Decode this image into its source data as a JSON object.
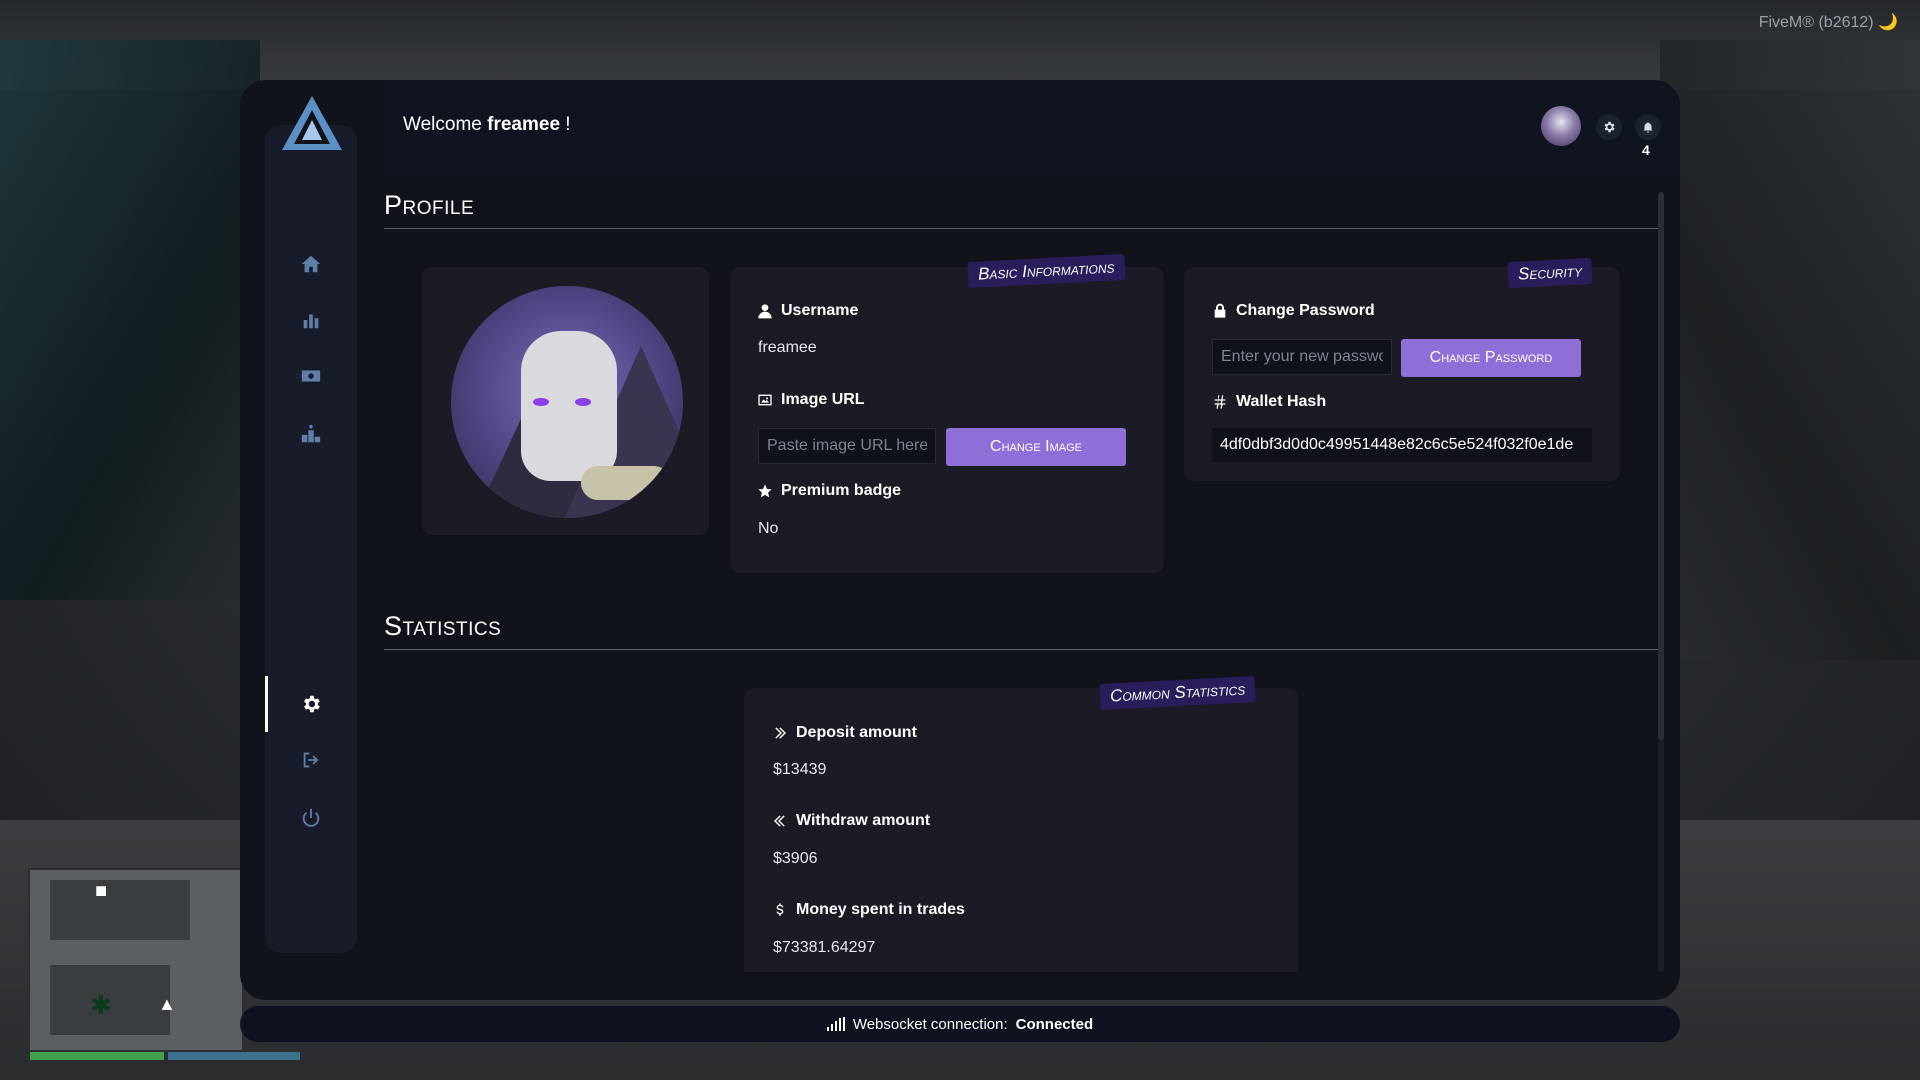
{
  "overlay": {
    "build_tag": "FiveM® (b2612) 🌙"
  },
  "header": {
    "welcome_prefix": "Welcome",
    "username": "freamee",
    "welcome_suffix": "!",
    "notification_count": "4"
  },
  "profile": {
    "section_title": "Profile",
    "basic": {
      "tag": "Basic Informations",
      "username_label": "Username",
      "username_value": "freamee",
      "image_label": "Image URL",
      "image_placeholder": "Paste image URL here...",
      "change_image_button": "Change Image",
      "premium_label": "Premium badge",
      "premium_value": "No"
    },
    "security": {
      "tag": "Security",
      "change_password_label": "Change Password",
      "password_placeholder": "Enter your new password",
      "change_password_button": "Change Password",
      "wallet_label": "Wallet Hash",
      "wallet_value": "4df0dbf3d0d0c49951448e82c6c5e524f032f0e1de"
    }
  },
  "statistics": {
    "section_title": "Statistics",
    "tag": "Common Statistics",
    "deposit_label": "Deposit amount",
    "deposit_value": "$13439",
    "withdraw_label": "Withdraw amount",
    "withdraw_value": "$3906",
    "spent_label": "Money spent in trades",
    "spent_value": "$73381.64297"
  },
  "status": {
    "label": "Websocket connection:",
    "value": "Connected"
  },
  "sidebar": {
    "items": [
      {
        "name": "home",
        "icon": "home-icon"
      },
      {
        "name": "stats",
        "icon": "bar-chart-icon"
      },
      {
        "name": "money",
        "icon": "money-icon"
      },
      {
        "name": "leaderboard",
        "icon": "podium-icon"
      },
      {
        "name": "settings",
        "icon": "gear-icon",
        "active": true
      },
      {
        "name": "logout",
        "icon": "sign-out-icon"
      },
      {
        "name": "power",
        "icon": "power-icon"
      }
    ]
  },
  "colors": {
    "accent": "#8f6ed8",
    "tag_bg": "#2b1c5c",
    "panel_bg": "#11131a",
    "card_bg": "#1a1b25"
  }
}
